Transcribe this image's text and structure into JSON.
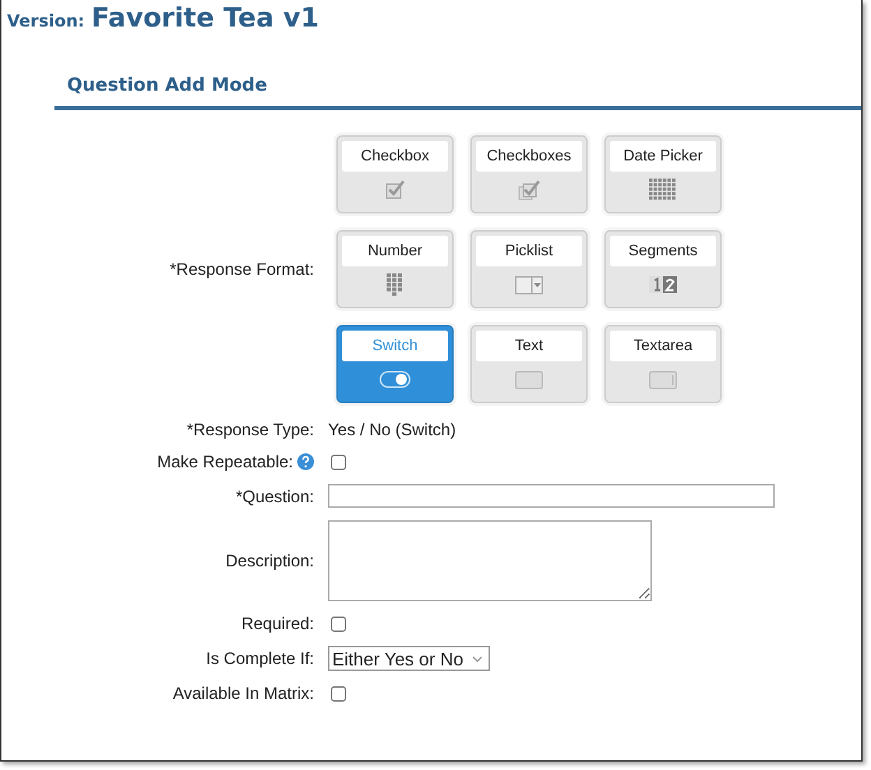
{
  "version_label": "Version:",
  "version_title": "Favorite Tea v1",
  "section_title": "Question Add Mode",
  "response_format": {
    "label": "*Response Format:",
    "options": [
      {
        "label": "Checkbox",
        "kind": "checkbox",
        "selected": false
      },
      {
        "label": "Checkboxes",
        "kind": "checkboxes",
        "selected": false
      },
      {
        "label": "Date Picker",
        "kind": "date",
        "selected": false
      },
      {
        "label": "Number",
        "kind": "number",
        "selected": false
      },
      {
        "label": "Picklist",
        "kind": "picklist",
        "selected": false
      },
      {
        "label": "Segments",
        "kind": "segments",
        "selected": false
      },
      {
        "label": "Switch",
        "kind": "switch",
        "selected": true
      },
      {
        "label": "Text",
        "kind": "text",
        "selected": false
      },
      {
        "label": "Textarea",
        "kind": "textarea",
        "selected": false
      }
    ]
  },
  "fields": [
    {
      "label": "*Response Type:",
      "kind": "static",
      "value": "Yes / No (Switch)"
    },
    {
      "label": "Make Repeatable:",
      "kind": "checkbox",
      "checked": false,
      "help": true
    },
    {
      "label": "*Question:",
      "kind": "input"
    },
    {
      "label": "Description:",
      "kind": "textarea"
    },
    {
      "label": "Required:",
      "kind": "checkbox",
      "checked": false
    },
    {
      "label": "Is Complete If:",
      "kind": "select",
      "value": "Either Yes or No"
    },
    {
      "label": "Available In Matrix:",
      "kind": "checkbox",
      "checked": false
    }
  ]
}
